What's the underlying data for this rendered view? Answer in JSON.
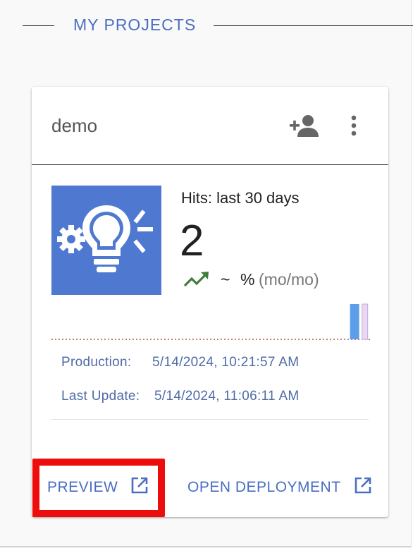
{
  "section": {
    "title": "MY PROJECTS"
  },
  "card": {
    "title": "demo",
    "add_user_icon": "person-add-icon",
    "more_icon": "more-vert-icon",
    "thumbnail_icon": "lightbulb-gear-icon",
    "hits_label": "Hits: last 30 days",
    "hits_value": "2",
    "trend_icon": "trending-up-icon",
    "trend_tilde": "~",
    "trend_percent": "%",
    "trend_period": "(mo/mo)",
    "production_label": "Production:",
    "production_value": "5/14/2024, 10:21:57 AM",
    "last_update_label": "Last Update:",
    "last_update_value": "5/14/2024, 11:06:11 AM",
    "actions": {
      "preview": "PREVIEW",
      "open_deployment": "OPEN DEPLOYMENT",
      "external_icon": "open-in-new-icon"
    }
  },
  "colors": {
    "accent": "#4a6ec2",
    "thumbnail_bg": "#4f79d1",
    "trend_green": "#3e7d3a",
    "highlight": "#ee0d0d",
    "bar_blue": "#5c9eea",
    "bar_lavender": "#e8d8f2"
  },
  "chart_data": {
    "type": "bar",
    "values": [
      0,
      0,
      0,
      0,
      0,
      0,
      0,
      0,
      0,
      0,
      0,
      0,
      0,
      0,
      0,
      0,
      0,
      0,
      0,
      0,
      0,
      0,
      0,
      0,
      0,
      0,
      0,
      0,
      0,
      1,
      1
    ],
    "bar_colors": [
      "#5c9eea",
      "#e8d8f2"
    ]
  }
}
